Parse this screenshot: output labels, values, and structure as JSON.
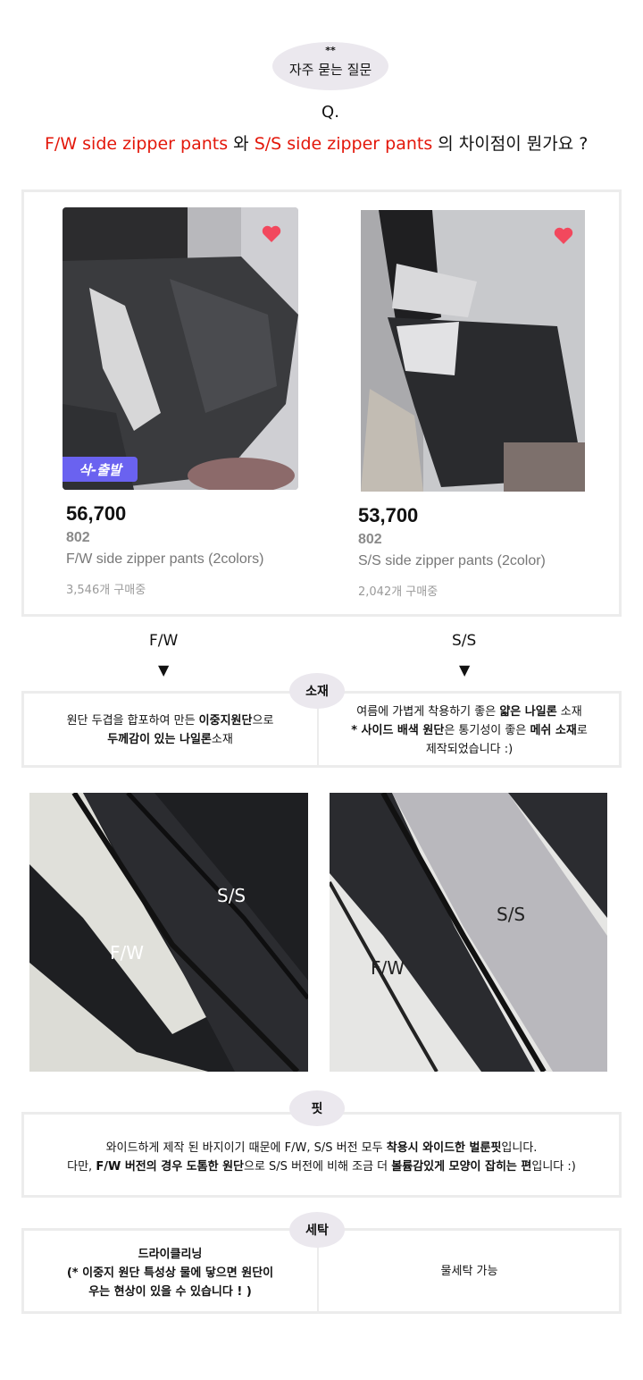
{
  "header": {
    "stars": "**",
    "faq_label": "자주 묻는 질문",
    "q_label": "Q.",
    "question": {
      "part1": "F/W side zipper pants",
      "part2": " 와 ",
      "part3": "S/S side zipper pants",
      "part4": " 의 차이점이 뭔가요 ?"
    }
  },
  "products": [
    {
      "badge": "삭-출발",
      "price": "56,700",
      "brand": "802",
      "name": "F/W side zipper pants (2colors)",
      "sold": "3,546개 구매중"
    },
    {
      "badge": "",
      "price": "53,700",
      "brand": "802",
      "name": "S/S side zipper pants (2color)",
      "sold": "2,042개 구매중"
    }
  ],
  "compare": {
    "left_label": "F/W",
    "right_label": "S/S",
    "arrow": "▼"
  },
  "material": {
    "title": "소재",
    "left": {
      "l1a": "원단 두겹을 합포하여 만든 ",
      "l1b": "이중지원단",
      "l1c": "으로",
      "l2a": "두께감이 있는 나일론",
      "l2b": "소재"
    },
    "right": {
      "l1a": "여름에 가볍게 착용하기 좋은 ",
      "l1b": "얇은 나일론",
      "l1c": " 소재",
      "l2a": "* 사이드 배색 원단",
      "l2b": "은 통기성이 좋은 ",
      "l2c": "메쉬 소재",
      "l2d": "로",
      "l3": "제작되었습니다 :)"
    }
  },
  "detail_photos": [
    {
      "label_ss": "S/S",
      "label_fw": "F/W"
    },
    {
      "label_ss": "S/S",
      "label_fw": "F/W"
    }
  ],
  "fit": {
    "title": "핏",
    "l1a": "와이드하게 제작 된 바지이기 때문에 F/W, S/S 버전 모두 ",
    "l1b": "착용시 와이드한 벌룬핏",
    "l1c": "입니다.",
    "l2a": "다만, ",
    "l2b": "F/W 버전의 경우 도톰한 원단",
    "l2c": "으로 S/S 버전에 비해 조금 더 ",
    "l2d": "볼륨감있게 모양이 잡히는 편",
    "l2e": "입니다 :)"
  },
  "wash": {
    "title": "세탁",
    "left_l1": "드라이클리닝",
    "left_l2": "(* 이중지 원단 특성상 물에 닿으면 원단이",
    "left_l3": "우는 현상이 있을 수 있습니다 ! )",
    "right": "물세탁 가능"
  },
  "colors": {
    "accent_red": "#e3170a",
    "pill_bg": "#ebe8ee",
    "border": "#ececec",
    "badge_bg": "#6a62f0",
    "heart": "#f2485d"
  },
  "icons": [
    "heart-icon",
    "down-triangle-icon"
  ]
}
